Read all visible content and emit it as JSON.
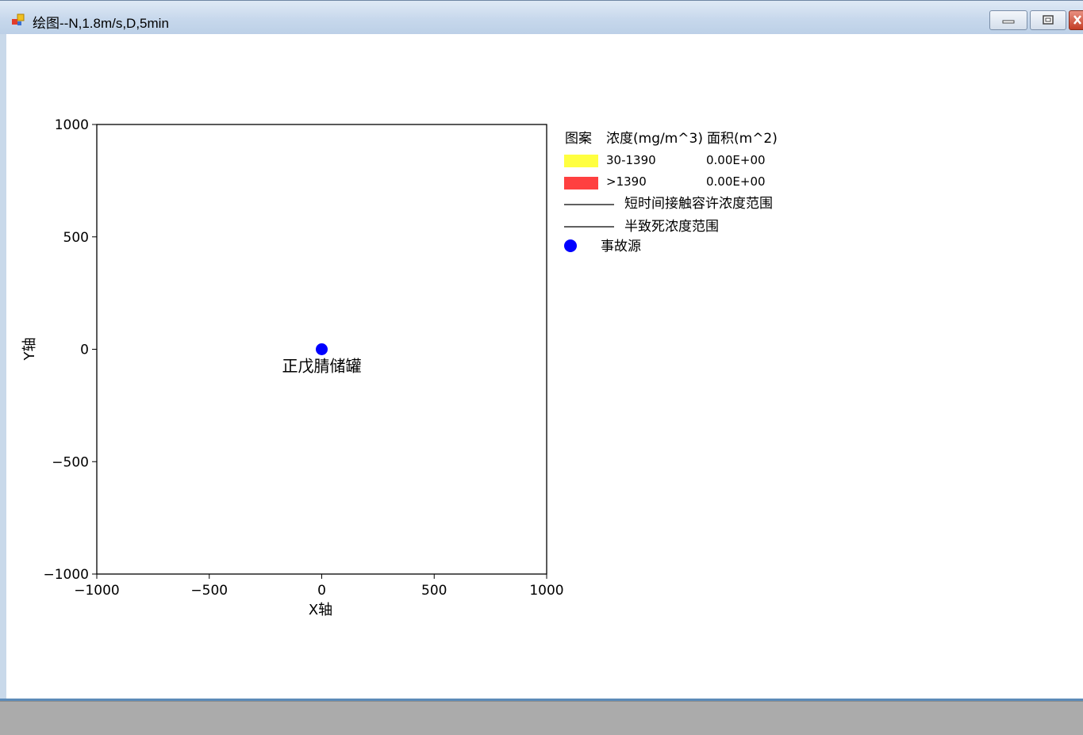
{
  "window": {
    "title": "绘图--N,1.8m/s,D,5min",
    "icon": "chart-app-icon",
    "controls": [
      "minimize-icon",
      "restore-icon",
      "close-icon"
    ]
  },
  "chart_data": {
    "type": "scatter",
    "xlabel": "X轴",
    "ylabel": "Y轴",
    "xlim": [
      -1000,
      1000
    ],
    "ylim": [
      -1000,
      1000
    ],
    "xticks": [
      -1000,
      -500,
      0,
      500,
      1000
    ],
    "yticks": [
      -1000,
      -500,
      0,
      500,
      1000
    ],
    "x_tick_labels": [
      "−1000",
      "−500",
      "0",
      "500",
      "1000"
    ],
    "y_tick_labels": [
      "−1000",
      "−500",
      "0",
      "500",
      "1000"
    ],
    "grid": false,
    "points": [
      {
        "x": 0,
        "y": 0,
        "label": "正戊腈储罐",
        "color": "#0000ff"
      }
    ],
    "legend": {
      "placement": "right",
      "header": [
        "图案",
        "浓度(mg/m^3)",
        "面积(m^2)"
      ],
      "rows": [
        {
          "type": "swatch",
          "color": "#ffff40",
          "range": "30-1390",
          "area": "0.00E+00"
        },
        {
          "type": "swatch",
          "color": "#ff4040",
          "range": ">1390",
          "area": "0.00E+00"
        },
        {
          "type": "line",
          "label": "短时间接触容许浓度范围"
        },
        {
          "type": "line",
          "label": "半致死浓度范围"
        },
        {
          "type": "dot",
          "color": "#0000ff",
          "label": "事故源"
        }
      ]
    }
  }
}
